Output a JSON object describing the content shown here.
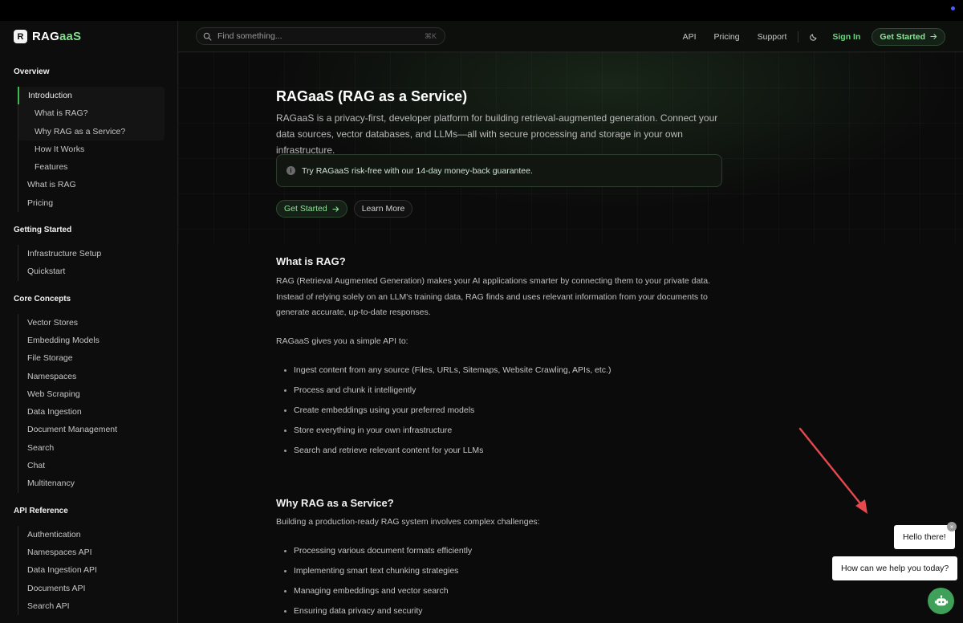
{
  "brand": {
    "prefix": "RAG",
    "suffix": "aaS",
    "logo_letter": "R"
  },
  "header": {
    "search_placeholder": "Find something...",
    "search_shortcut": "⌘K",
    "links": [
      "API",
      "Pricing",
      "Support"
    ],
    "sign_in": "Sign In",
    "get_started": "Get Started",
    "theme_icon": "moon-icon"
  },
  "sidebar": {
    "sections": [
      {
        "title": "Overview"
      },
      {
        "title": "Getting Started"
      },
      {
        "title": "Core Concepts"
      },
      {
        "title": "API Reference"
      }
    ],
    "overview": {
      "intro": "Introduction",
      "intro_sub": [
        "What is RAG?",
        "Why RAG as a Service?",
        "How It Works",
        "Features"
      ],
      "rest": [
        "What is RAG",
        "Pricing"
      ]
    },
    "getting_started": [
      "Infrastructure Setup",
      "Quickstart"
    ],
    "core_concepts": [
      "Vector Stores",
      "Embedding Models",
      "File Storage",
      "Namespaces",
      "Web Scraping",
      "Data Ingestion",
      "Document Management",
      "Search",
      "Chat",
      "Multitenancy"
    ],
    "api_reference": [
      "Authentication",
      "Namespaces API",
      "Data Ingestion API",
      "Documents API",
      "Search API"
    ]
  },
  "main": {
    "title": "RAGaaS (RAG as a Service)",
    "lead": "RAGaaS is a privacy-first, developer platform for building retrieval-augmented generation. Connect your data sources, vector databases, and LLMs—all with secure processing and storage in your own infrastructure.",
    "callout": "Try RAGaaS risk-free with our 14-day money-back guarantee.",
    "cta_primary": "Get Started",
    "cta_secondary": "Learn More",
    "what_title": "What is RAG?",
    "what_body": "RAG (Retrieval Augmented Generation) makes your AI applications smarter by connecting them to your private data. Instead of relying solely on an LLM's training data, RAG finds and uses relevant information from your documents to generate accurate, up-to-date responses.",
    "api_intro": "RAGaaS gives you a simple API to:",
    "api_items": [
      "Ingest content from any source (Files, URLs, Sitemaps, Website Crawling, APIs, etc.)",
      "Process and chunk it intelligently",
      "Create embeddings using your preferred models",
      "Store everything in your own infrastructure",
      "Search and retrieve relevant content for your LLMs"
    ],
    "why_title": "Why RAG as a Service?",
    "why_intro": "Building a production-ready RAG system involves complex challenges:",
    "why_items": [
      "Processing various document formats efficiently",
      "Implementing smart text chunking strategies",
      "Managing embeddings and vector search",
      "Ensuring data privacy and security"
    ]
  },
  "chat": {
    "greeting": "Hello there!",
    "prompt": "How can we help you today?",
    "close_glyph": "×",
    "arrow_color": "#e5484d"
  },
  "colors": {
    "accent": "#3fb950",
    "accent_text": "#8fe39a",
    "background": "#0b0b0b"
  }
}
